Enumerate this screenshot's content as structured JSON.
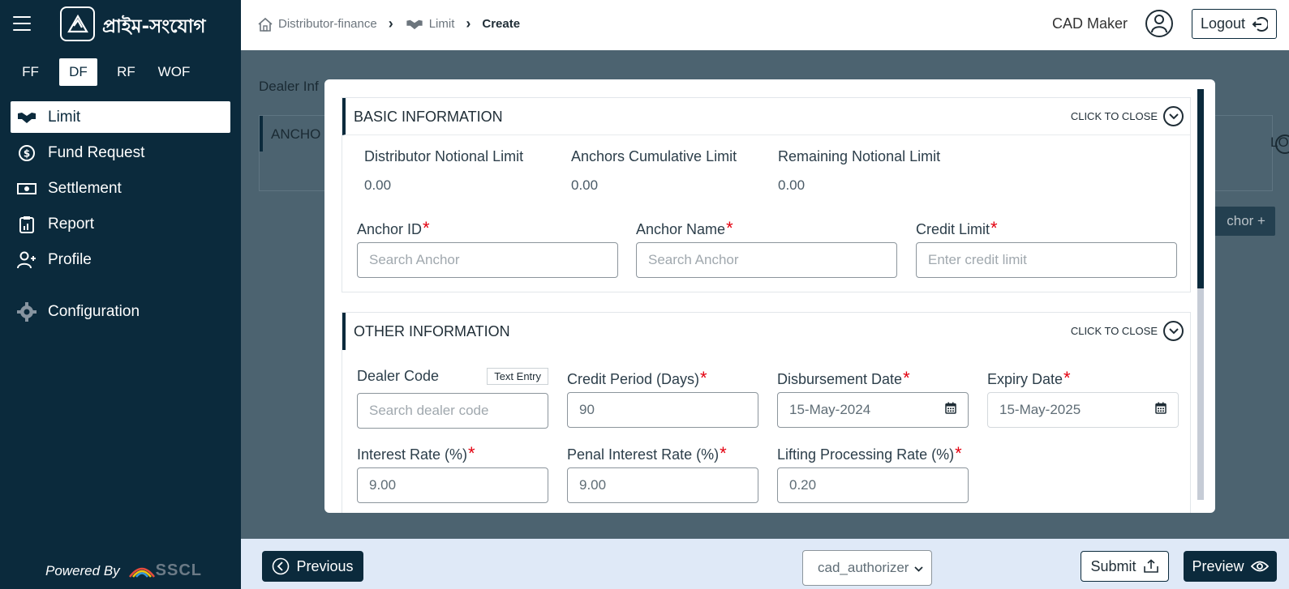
{
  "brand": {
    "name": "প্রাইম-সংযোগ",
    "powered_by": "Powered By",
    "vendor": "SSCL"
  },
  "modules": [
    {
      "label": "FF",
      "active": false
    },
    {
      "label": "DF",
      "active": true
    },
    {
      "label": "RF",
      "active": false
    },
    {
      "label": "WOF",
      "active": false
    }
  ],
  "nav": [
    {
      "label": "Limit",
      "icon": "handshake-icon",
      "active": true
    },
    {
      "label": "Fund Request",
      "icon": "dollar-circle-icon",
      "active": false
    },
    {
      "label": "Settlement",
      "icon": "cash-icon",
      "active": false
    },
    {
      "label": "Report",
      "icon": "clipboard-icon",
      "active": false
    },
    {
      "label": "Profile",
      "icon": "user-plus-icon",
      "active": false
    },
    {
      "label": "Configuration",
      "icon": "gear-icon",
      "active": false
    }
  ],
  "breadcrumb": {
    "home": "Distributor-finance",
    "section": "Limit",
    "current": "Create"
  },
  "user": {
    "role": "CAD Maker",
    "logout": "Logout"
  },
  "background": {
    "label": "Dealer Inf",
    "panel_title": "ANCHO",
    "close": "LOSE",
    "add": "chor +"
  },
  "basic_info": {
    "title": "BASIC INFORMATION",
    "close_label": "CLICK TO CLOSE",
    "stats": [
      {
        "label": "Distributor Notional Limit",
        "value": "0.00"
      },
      {
        "label": "Anchors Cumulative Limit",
        "value": "0.00"
      },
      {
        "label": "Remaining Notional Limit",
        "value": "0.00"
      }
    ],
    "fields": {
      "anchor_id": {
        "label": "Anchor ID",
        "placeholder": "Search Anchor"
      },
      "anchor_name": {
        "label": "Anchor Name",
        "placeholder": "Search Anchor"
      },
      "credit_limit": {
        "label": "Credit Limit",
        "placeholder": "Enter credit limit"
      }
    }
  },
  "other_info": {
    "title": "OTHER INFORMATION",
    "close_label": "CLICK TO CLOSE",
    "fields": {
      "dealer_code": {
        "label": "Dealer Code",
        "tag": "Text Entry",
        "placeholder": "Search dealer code"
      },
      "credit_period": {
        "label": "Credit Period (Days)",
        "value": "90"
      },
      "disbursement_date": {
        "label": "Disbursement Date",
        "value": "15-May-2024"
      },
      "expiry_date": {
        "label": "Expiry Date",
        "value": "15-May-2025"
      },
      "interest_rate": {
        "label": "Interest Rate (%)",
        "value": "9.00"
      },
      "penal_interest_rate": {
        "label": "Penal Interest Rate (%)",
        "value": "9.00"
      },
      "lifting_processing_rate": {
        "label": "Lifting Processing Rate (%)",
        "value": "0.20"
      }
    }
  },
  "footer": {
    "previous": "Previous",
    "authorizer": "cad_authorizer",
    "submit": "Submit",
    "preview": "Preview"
  },
  "colors": {
    "primary": "#0b2a3c",
    "backdrop": "#4c6370",
    "required": "#e3000f",
    "footer_bg": "#dfe9f7"
  }
}
